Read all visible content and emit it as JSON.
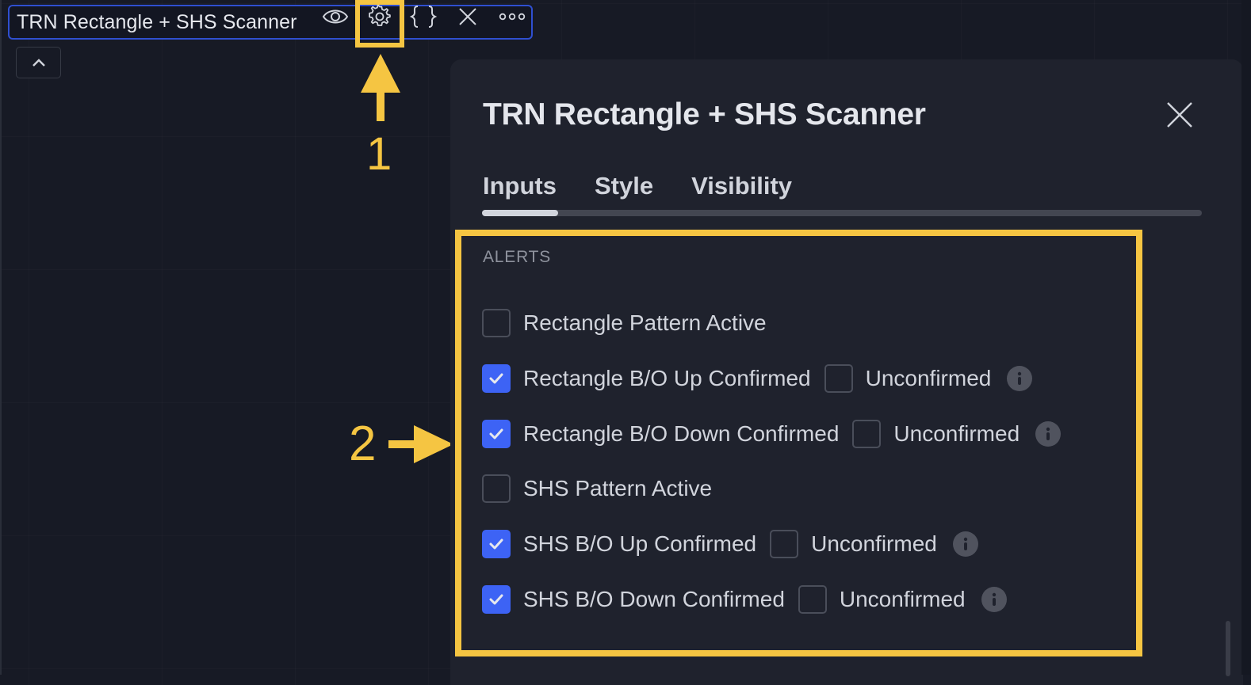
{
  "legend": {
    "title": "TRN Rectangle + SHS Scanner",
    "icons": [
      "eye-icon",
      "gear-icon",
      "braces-icon",
      "close-icon",
      "more-icon"
    ]
  },
  "collapse_button": {
    "icon": "chevron-up-icon"
  },
  "annotations": {
    "step1": "1",
    "step2": "2",
    "highlight_color": "#f5c542"
  },
  "dialog": {
    "title": "TRN Rectangle + SHS Scanner",
    "close_icon": "close-icon",
    "tabs": [
      {
        "label": "Inputs",
        "active": true
      },
      {
        "label": "Style",
        "active": false
      },
      {
        "label": "Visibility",
        "active": false
      }
    ],
    "section_label": "ALERTS",
    "rows": [
      {
        "label": "Rectangle Pattern Active",
        "checked": false
      },
      {
        "label": "Rectangle B/O Up Confirmed",
        "checked": true,
        "secondary": {
          "label": "Unconfirmed",
          "checked": false
        },
        "info": true
      },
      {
        "label": "Rectangle B/O Down Confirmed",
        "checked": true,
        "secondary": {
          "label": "Unconfirmed",
          "checked": false
        },
        "info": true
      },
      {
        "label": "SHS Pattern Active",
        "checked": false
      },
      {
        "label": "SHS B/O Up Confirmed",
        "checked": true,
        "secondary": {
          "label": "Unconfirmed",
          "checked": false
        },
        "info": true
      },
      {
        "label": "SHS B/O Down Confirmed",
        "checked": true,
        "secondary": {
          "label": "Unconfirmed",
          "checked": false
        },
        "info": true
      }
    ]
  },
  "colors": {
    "accent": "#3d63f5",
    "legend_border": "#2f4fd0",
    "background": "#171a25",
    "dialog_bg": "#1f222d"
  }
}
